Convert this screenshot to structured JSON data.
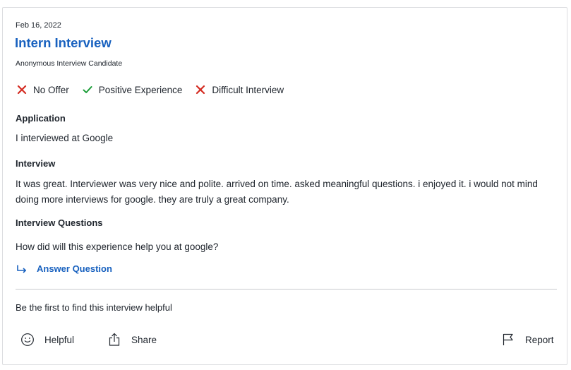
{
  "review": {
    "date": "Feb 16, 2022",
    "title": "Intern Interview",
    "author": "Anonymous Interview Candidate",
    "ratings": [
      {
        "icon": "x-icon",
        "label": "No Offer",
        "color": "#d42c22"
      },
      {
        "icon": "check-icon",
        "label": "Positive Experience",
        "color": "#1d9e3a"
      },
      {
        "icon": "x-icon",
        "label": "Difficult Interview",
        "color": "#d42c22"
      }
    ],
    "application_label": "Application",
    "application_text": "I interviewed at Google",
    "interview_label": "Interview",
    "interview_text": "It was great. Interviewer was very nice and polite. arrived on time. asked meaningful questions. i enjoyed it. i would not mind doing more interviews for google. they are truly a great company.",
    "questions_label": "Interview Questions",
    "question_text": "How did will this experience help you at google?",
    "answer_label": "Answer Question"
  },
  "footer": {
    "helpful_prompt": "Be the first to find this interview helpful",
    "helpful_label": "Helpful",
    "share_label": "Share",
    "report_label": "Report"
  },
  "colors": {
    "link": "#1861bf",
    "negative": "#d42c22",
    "positive": "#1d9e3a"
  }
}
